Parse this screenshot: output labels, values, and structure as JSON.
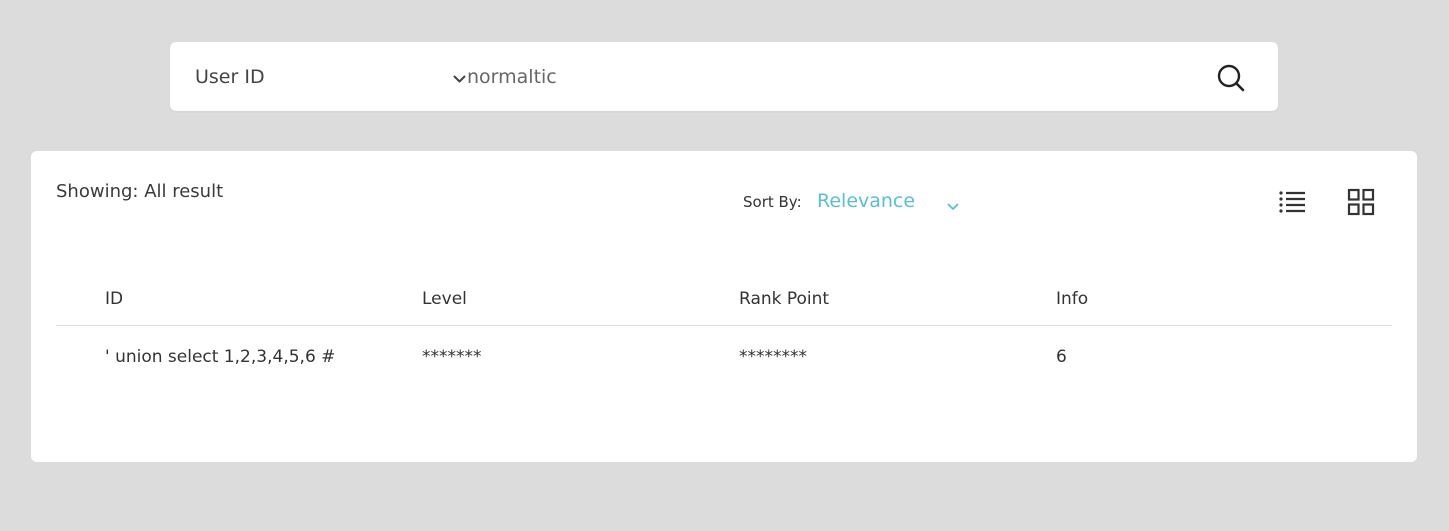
{
  "search": {
    "filter_label": "User ID",
    "query": "normaltic"
  },
  "results": {
    "showing_label": "Showing: All result",
    "sort_label": "Sort By:",
    "sort_value": "Relevance",
    "accent_color": "#5bbfd0",
    "columns": [
      "ID",
      "Level",
      "Rank Point",
      "Info"
    ],
    "rows": [
      [
        "' union select 1,2,3,4,5,6 #",
        "*******",
        "********",
        "6"
      ]
    ]
  },
  "icons": {
    "filter_chevron": "chevron-down-icon",
    "search": "search-icon",
    "sort_chevron": "chevron-down-icon",
    "list_view": "list-view-icon",
    "grid_view": "grid-view-icon"
  }
}
